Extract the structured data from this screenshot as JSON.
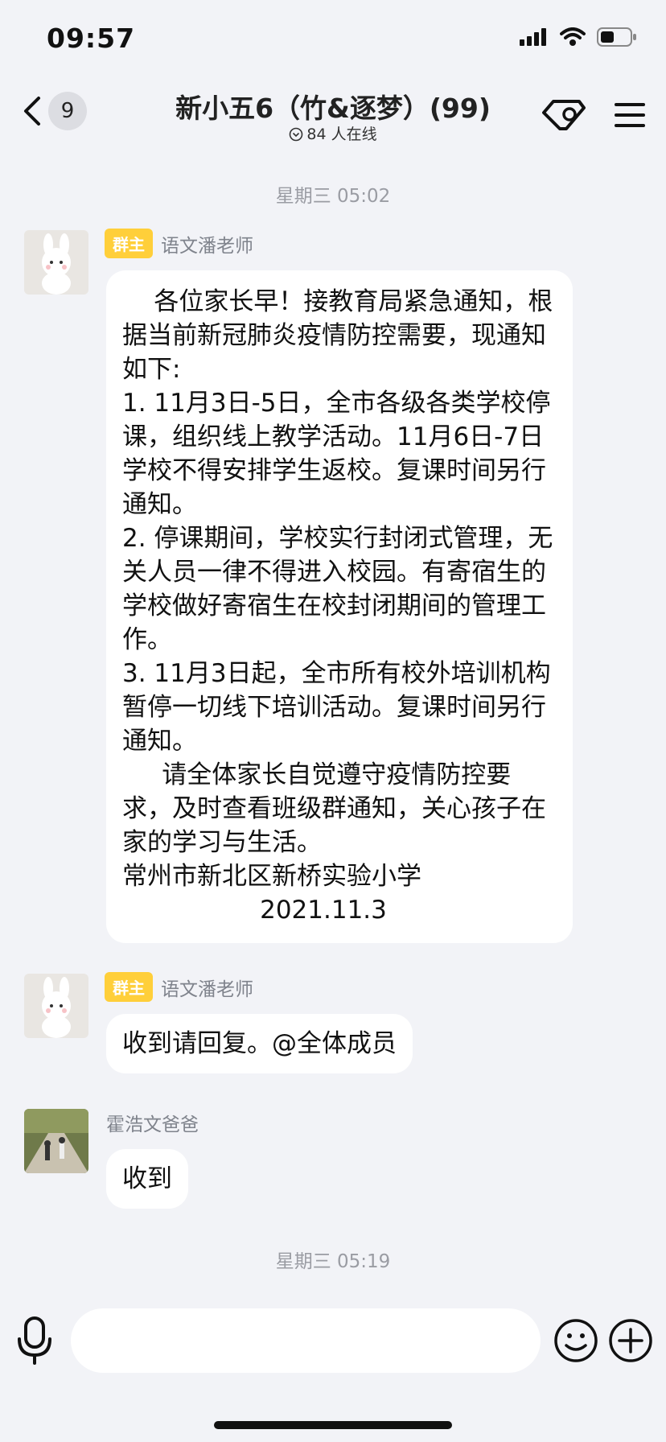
{
  "status": {
    "time": "09:57"
  },
  "nav": {
    "unread_count": "9",
    "group_title": "新小五6（竹&逐梦）(99)",
    "online_text": "84 人在线"
  },
  "messages": {
    "timestamp1": "星期三 05:02",
    "msg1": {
      "badge": "群主",
      "sender": "语文潘老师",
      "paragraphs": [
        "    各位家长早！接教育局紧急通知，根据当前新冠肺炎疫情防控需要，现通知如下:",
        "1. 11月3日-5日，全市各级各类学校停课，组织线上教学活动。11月6日-7日学校不得安排学生返校。复课时间另行通知。",
        "2. 停课期间，学校实行封闭式管理，无关人员一律不得进入校园。有寄宿生的学校做好寄宿生在校封闭期间的管理工作。",
        "3. 11月3日起，全市所有校外培训机构暂停一切线下培训活动。复课时间另行通知。",
        "     请全体家长自觉遵守疫情防控要求，及时查看班级群通知，关心孩子在家的学习与生活。",
        "常州市新北区新桥实验小学"
      ],
      "date": "2021.11.3"
    },
    "msg2": {
      "badge": "群主",
      "sender": "语文潘老师",
      "text": "收到请回复。@全体成员"
    },
    "msg3": {
      "sender": "霍浩文爸爸",
      "text": "收到"
    },
    "timestamp2": "星期三 05:19"
  },
  "colors": {
    "background": "#f2f3f7",
    "owner_badge": "#ffcf3a",
    "bubble": "#ffffff"
  },
  "icons": [
    "signal-icon",
    "wifi-icon",
    "battery-icon",
    "back-chevron-icon",
    "ticket-icon",
    "menu-icon",
    "microphone-icon",
    "emoji-icon",
    "plus-icon"
  ]
}
